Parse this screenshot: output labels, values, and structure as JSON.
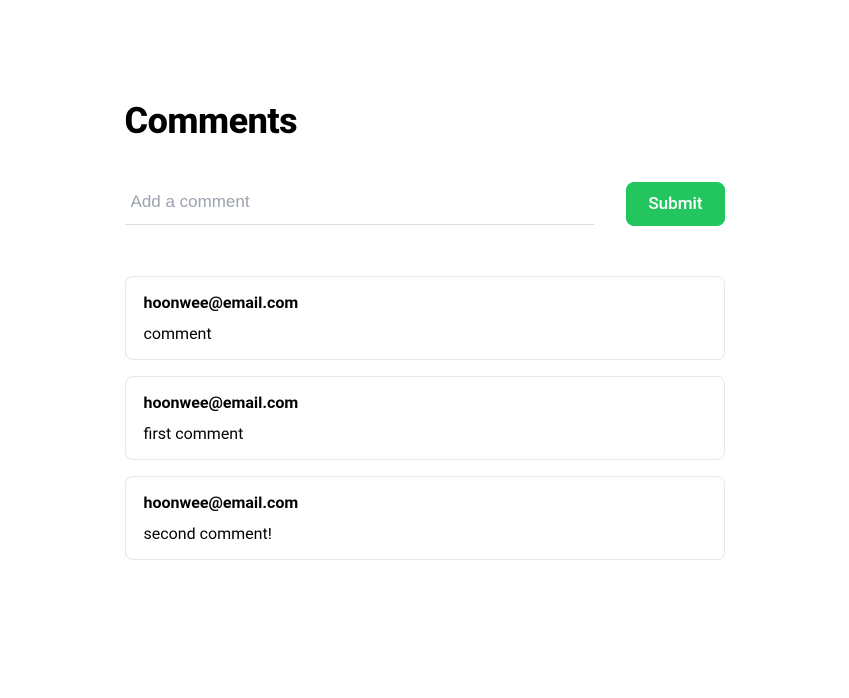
{
  "title": "Comments",
  "form": {
    "placeholder": "Add a comment",
    "submit_label": "Submit"
  },
  "comments": [
    {
      "author": "hoonwee@email.com",
      "body": "comment"
    },
    {
      "author": "hoonwee@email.com",
      "body": "first comment"
    },
    {
      "author": "hoonwee@email.com",
      "body": "second comment!"
    }
  ]
}
